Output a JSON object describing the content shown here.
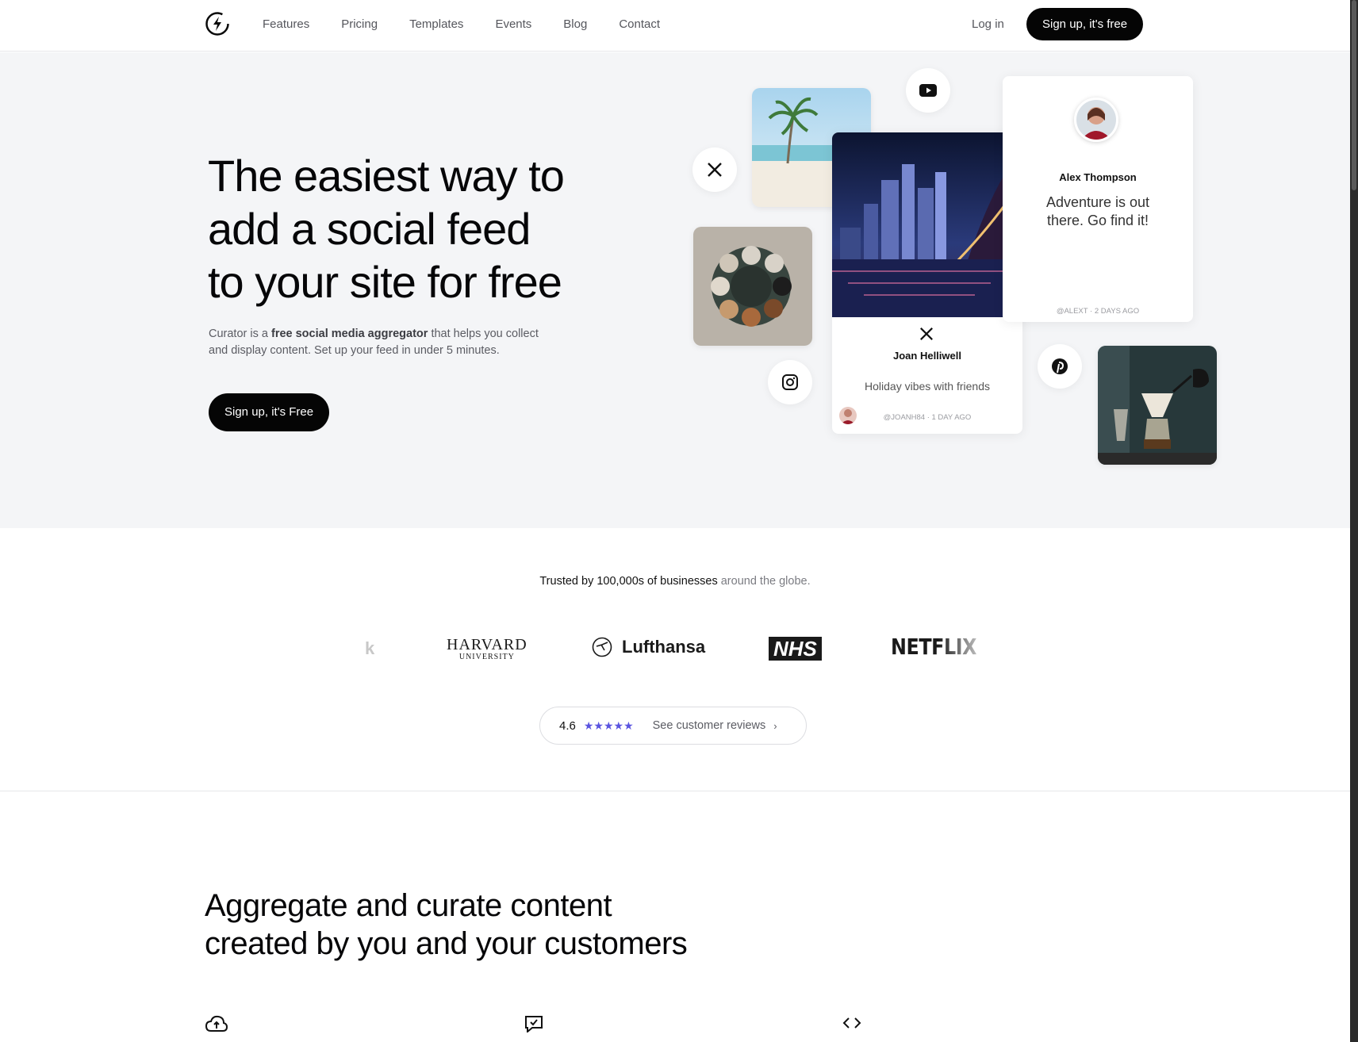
{
  "nav": {
    "links": [
      "Features",
      "Pricing",
      "Templates",
      "Events",
      "Blog",
      "Contact"
    ],
    "login": "Log in",
    "cta": "Sign up, it's free"
  },
  "hero": {
    "title_lines": [
      "The easiest way to",
      "add a social feed",
      "to your site for free"
    ],
    "desc_prefix": "Curator is a ",
    "desc_bold": "free social media aggregator",
    "desc_suffix": " that helps you collect and display content. Set up your feed in under 5 minutes.",
    "cta": "Sign up, it's Free"
  },
  "collage": {
    "alex": {
      "name": "Alex Thompson",
      "text": "Adventure is out there. Go find it!",
      "meta": "@ALEXT · 2 DAYS AGO"
    },
    "joan": {
      "name": "Joan Helliwell",
      "text": "Holiday vibes with friends",
      "meta": "@JOANH84 · 1 DAY AGO"
    },
    "icons": [
      "x-icon",
      "youtube-icon",
      "instagram-icon",
      "pinterest-icon"
    ]
  },
  "trusted": {
    "bold": "Trusted by 100,000s of businesses",
    "muted": " around the globe."
  },
  "logos": {
    "partial": "k",
    "harvard_main": "HARVARD",
    "harvard_sub": "UNIVERSITY",
    "lufthansa": "Lufthansa",
    "nhs": "NHS",
    "netflix": "NETFLIX"
  },
  "rating": {
    "score": "4.6",
    "stars": "★★★★★",
    "link": "See customer reviews",
    "chevron": "›"
  },
  "features": {
    "title_lines": [
      "Aggregate and curate content",
      "created by you and your customers"
    ]
  },
  "colors": {
    "accent": "#5a54e0",
    "hero_bg": "#f4f5f7",
    "button": "#050505"
  }
}
